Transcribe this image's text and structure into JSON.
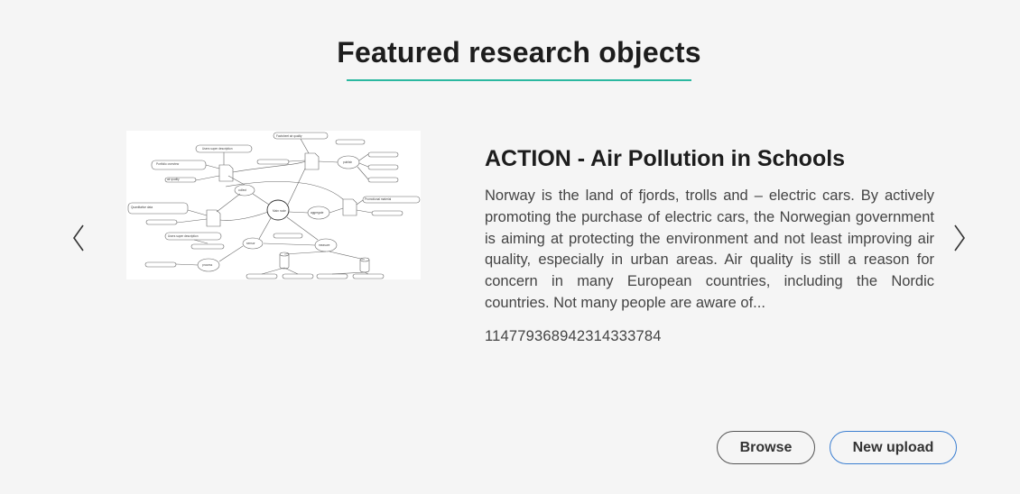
{
  "section": {
    "title": "Featured research objects"
  },
  "carousel": {
    "prev_icon": "chevron-left-icon",
    "next_icon": "chevron-right-icon",
    "item": {
      "image_alt": "diagram-thumbnail",
      "title": "ACTION - Air Pollution in Schools",
      "description": "Norway is the land of fjords, trolls and – electric cars. By actively promoting the purchase of electric cars, the Norwegian government is aiming at protecting the environment and not least improving air quality, especially in urban areas. Air quality is still a reason for concern in many European countries, including the Nordic countries. Not many people are aware of...",
      "id": "11477936894231433378​4"
    }
  },
  "actions": {
    "browse_label": "Browse",
    "upload_label": "New upload"
  },
  "colors": {
    "accent_underline": "#2bb8a0",
    "upload_border": "#3c7fd1",
    "background": "#f5f5f5"
  }
}
